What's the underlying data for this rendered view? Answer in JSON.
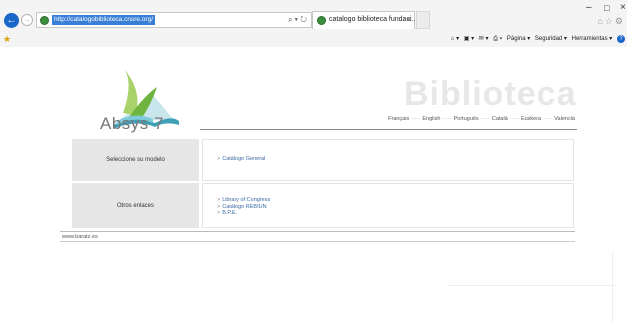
{
  "browser": {
    "url": "http://catalogobiblioteca.cnsre.org/",
    "tab_title": "catalogo biblioteca fundaci...",
    "tab_close": "×",
    "back_glyph": "←",
    "forward_glyph": "→",
    "window_controls": {
      "minimize": "–",
      "maximize": "□",
      "close": "×"
    },
    "address_icons": "⌕ ▾ ↻",
    "fav_icons": "⌂☆⚙",
    "command_bar": {
      "home": "⌂ ▾",
      "feeds": "▣ ▾",
      "mail": "✉ ▾",
      "print": "⎙ ▾",
      "page": "Página ▾",
      "safety": "Seguridad ▾",
      "tools": "Herramientas ▾",
      "help": "?"
    }
  },
  "page": {
    "logo_text": "Absys 7",
    "title": "Biblioteca",
    "languages": [
      "Français",
      "English",
      "Português",
      "Català",
      "Euskera",
      "Valencià"
    ],
    "language_separator": "·····",
    "rows": [
      {
        "label": "Seleccione su modelo",
        "links": [
          "Catálogo General"
        ]
      },
      {
        "label": "Otros enlaces",
        "links": [
          "Library of Congress",
          "Catálogo REBIUN",
          "B.P.E."
        ]
      }
    ],
    "link_prefix": ">",
    "footer_link": "www.baratz.es"
  },
  "colors": {
    "accent": "#1b66c9",
    "link": "#3a6aa5",
    "label_bg": "#e6e6e6",
    "title_watermark": "#e7e7e7"
  }
}
